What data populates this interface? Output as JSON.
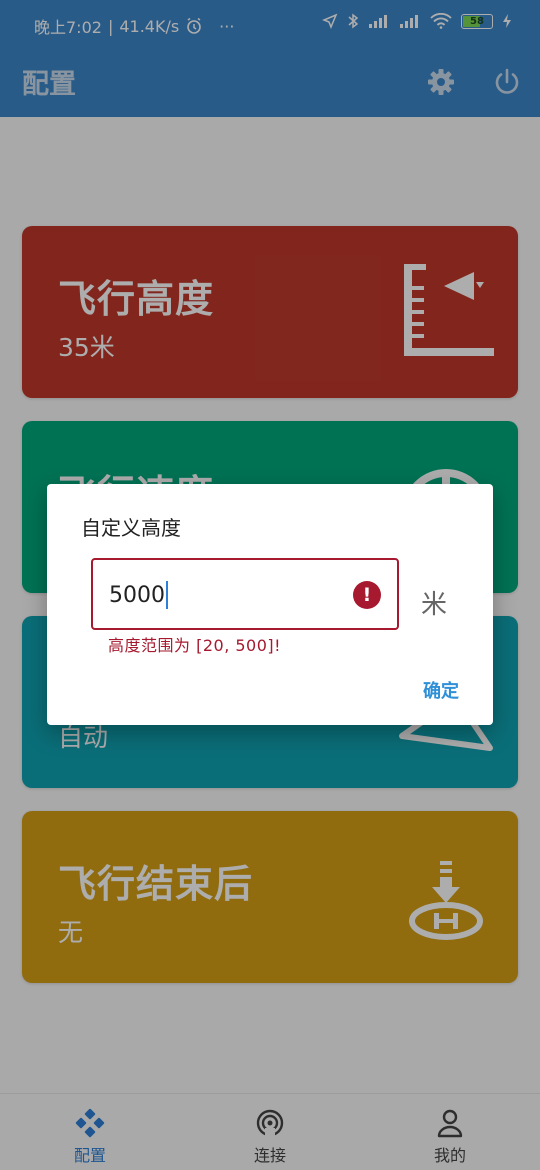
{
  "status_bar": {
    "time": "晚上7:02",
    "speed": "41.4K/s",
    "more": "···",
    "battery_level": "58"
  },
  "app_bar": {
    "title": "配置",
    "settings_icon": "gear-icon",
    "power_icon": "power-icon"
  },
  "cards": [
    {
      "title": "飞行高度",
      "value": "35米",
      "color": "#c0392b",
      "icon": "altitude-icon"
    },
    {
      "title": "飞行速度",
      "value": "",
      "color": "#00a87d",
      "icon": "speedometer-icon"
    },
    {
      "title": "",
      "value": "自动",
      "color": "#0fa3b1",
      "icon": "paper-plane-icon"
    },
    {
      "title": "飞行结束后",
      "value": "无",
      "color": "#d4a017",
      "icon": "landing-pad-icon"
    }
  ],
  "dialog": {
    "title": "自定义高度",
    "input_value": "5000",
    "unit": "米",
    "error": "高度范围为 [20, 500]!",
    "confirm_label": "确定"
  },
  "bottom_nav": [
    {
      "label": "配置",
      "icon": "gamepad-icon",
      "active": true
    },
    {
      "label": "连接",
      "icon": "signal-icon",
      "active": false
    },
    {
      "label": "我的",
      "icon": "person-icon",
      "active": false
    }
  ]
}
